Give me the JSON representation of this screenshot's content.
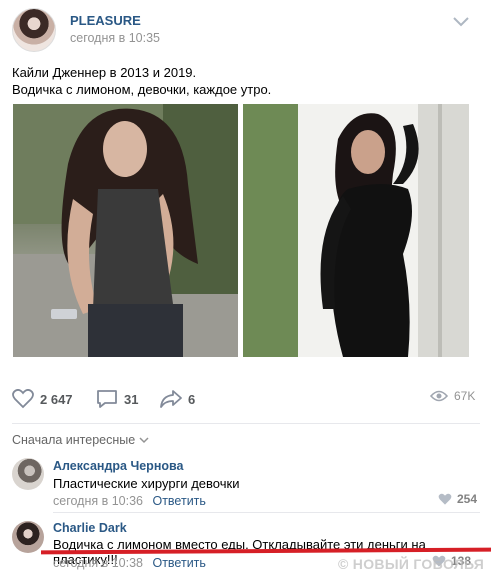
{
  "post": {
    "author": "PLEASURE",
    "time": "сегодня в 10:35",
    "text_line1": "Кайли Дженнер в 2013 и 2019.",
    "text_line2": "Водичка с лимоном, девочки, каждое утро."
  },
  "stats": {
    "likes": "2 647",
    "comments": "31",
    "shares": "6",
    "views": "67K"
  },
  "comments_sort": "Сначала интересные",
  "comments": [
    {
      "author": "Александра Чернова",
      "text": "Пластические хирурги девочки",
      "time": "сегодня в 10:36",
      "reply": "Ответить",
      "likes": "254"
    },
    {
      "author": "Charlie Dark",
      "text": "Водичка с лимоном вместо еды. Откладывайте эти деньги на пластику!!!",
      "time": "сегодня в 10:38",
      "reply": "Ответить",
      "likes": "138"
    }
  ],
  "watermark": "© НОВЫЙ ГОБОЛЬЯ",
  "icons": {
    "like": "heart-icon",
    "comment": "comment-icon",
    "share": "share-icon",
    "views": "eye-icon",
    "menu": "chevron-down-icon"
  },
  "colors": {
    "link": "#2a5885",
    "muted": "#939393",
    "highlight": "#d61f26"
  }
}
